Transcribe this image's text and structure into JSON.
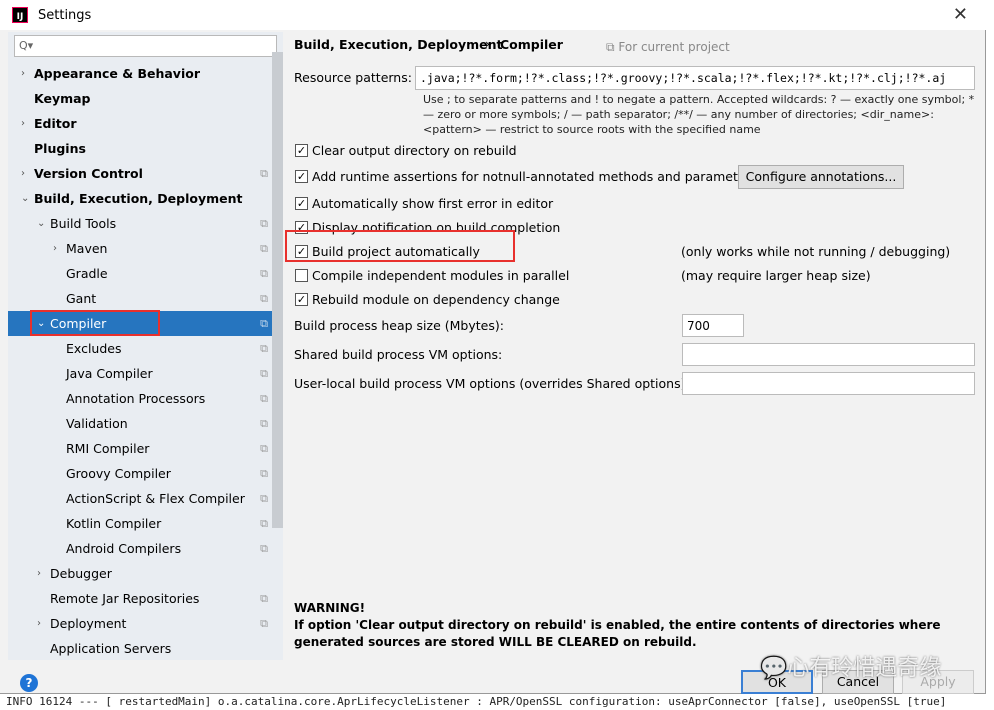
{
  "background_log": "INFO 16124 --- [  restartedMain] o.a.catalina.core.AprLifecycleListener   : APR/OpenSSL configuration: useAprConnector [false], useOpenSSL [true]",
  "window": {
    "title": "Settings",
    "close": "✕"
  },
  "search": {
    "placeholder": "Q▾"
  },
  "tree": [
    {
      "label": "Appearance & Behavior",
      "bold": true,
      "arrow": "›",
      "indent": 0
    },
    {
      "label": "Keymap",
      "bold": true,
      "indent": 0
    },
    {
      "label": "Editor",
      "bold": true,
      "arrow": "›",
      "indent": 0
    },
    {
      "label": "Plugins",
      "bold": true,
      "indent": 0
    },
    {
      "label": "Version Control",
      "bold": true,
      "arrow": "›",
      "indent": 0,
      "copy": true
    },
    {
      "label": "Build, Execution, Deployment",
      "bold": true,
      "arrow": "⌄",
      "indent": 0
    },
    {
      "label": "Build Tools",
      "arrow": "⌄",
      "indent": 1,
      "copy": true
    },
    {
      "label": "Maven",
      "arrow": "›",
      "indent": 2,
      "copy": true
    },
    {
      "label": "Gradle",
      "indent": 2,
      "copy": true
    },
    {
      "label": "Gant",
      "indent": 2,
      "copy": true
    },
    {
      "label": "Compiler",
      "arrow": "⌄",
      "indent": 1,
      "copy": true,
      "selected": true
    },
    {
      "label": "Excludes",
      "indent": 2,
      "copy": true
    },
    {
      "label": "Java Compiler",
      "indent": 2,
      "copy": true
    },
    {
      "label": "Annotation Processors",
      "indent": 2,
      "copy": true
    },
    {
      "label": "Validation",
      "indent": 2,
      "copy": true
    },
    {
      "label": "RMI Compiler",
      "indent": 2,
      "copy": true
    },
    {
      "label": "Groovy Compiler",
      "indent": 2,
      "copy": true
    },
    {
      "label": "ActionScript & Flex Compiler",
      "indent": 2,
      "copy": true
    },
    {
      "label": "Kotlin Compiler",
      "indent": 2,
      "copy": true
    },
    {
      "label": "Android Compilers",
      "indent": 2,
      "copy": true
    },
    {
      "label": "Debugger",
      "arrow": "›",
      "indent": 1
    },
    {
      "label": "Remote Jar Repositories",
      "indent": 1,
      "copy": true
    },
    {
      "label": "Deployment",
      "arrow": "›",
      "indent": 1,
      "copy": true
    },
    {
      "label": "Application Servers",
      "indent": 1
    }
  ],
  "breadcrumb": {
    "parent": "Build, Execution, Deployment",
    "sep": "›",
    "current": "Compiler",
    "scope": "For current project"
  },
  "resource": {
    "label": "Resource patterns:",
    "value": ".java;!?*.form;!?*.class;!?*.groovy;!?*.scala;!?*.flex;!?*.kt;!?*.clj;!?*.aj",
    "hint": "Use ; to separate patterns and ! to negate a pattern. Accepted wildcards: ? — exactly one symbol; * — zero or more symbols; / — path separator; /**/ — any number of directories; <dir_name>:<pattern> — restrict to source roots with the specified name"
  },
  "options": [
    {
      "label": "Clear output directory on rebuild",
      "checked": true
    },
    {
      "label": "Add runtime assertions for notnull-annotated methods and parameters",
      "checked": true
    },
    {
      "label": "Automatically show first error in editor",
      "checked": true
    },
    {
      "label": "Display notification on build completion",
      "checked": true
    },
    {
      "label": "Build project automatically",
      "checked": true,
      "note": "(only works while not running / debugging)"
    },
    {
      "label": "Compile independent modules in parallel",
      "checked": false,
      "note": "(may require larger heap size)"
    },
    {
      "label": "Rebuild module on dependency change",
      "checked": true
    }
  ],
  "configure_annotations": "Configure annotations...",
  "heap": {
    "label": "Build process heap size (Mbytes):",
    "value": "700"
  },
  "shared_vm": {
    "label": "Shared build process VM options:",
    "value": ""
  },
  "user_vm": {
    "label": "User-local build process VM options (overrides Shared options):",
    "value": ""
  },
  "warning": {
    "title": "WARNING!",
    "text": "If option 'Clear output directory on rebuild' is enabled, the entire contents of directories where generated sources are stored WILL BE CLEARED on rebuild."
  },
  "buttons": {
    "help": "?",
    "ok": "OK",
    "cancel": "Cancel",
    "apply": "Apply"
  },
  "watermark": "心有玲惜遇奇缘",
  "colors": {
    "selection": "#2675bf",
    "highlight_box": "#e8302d"
  }
}
